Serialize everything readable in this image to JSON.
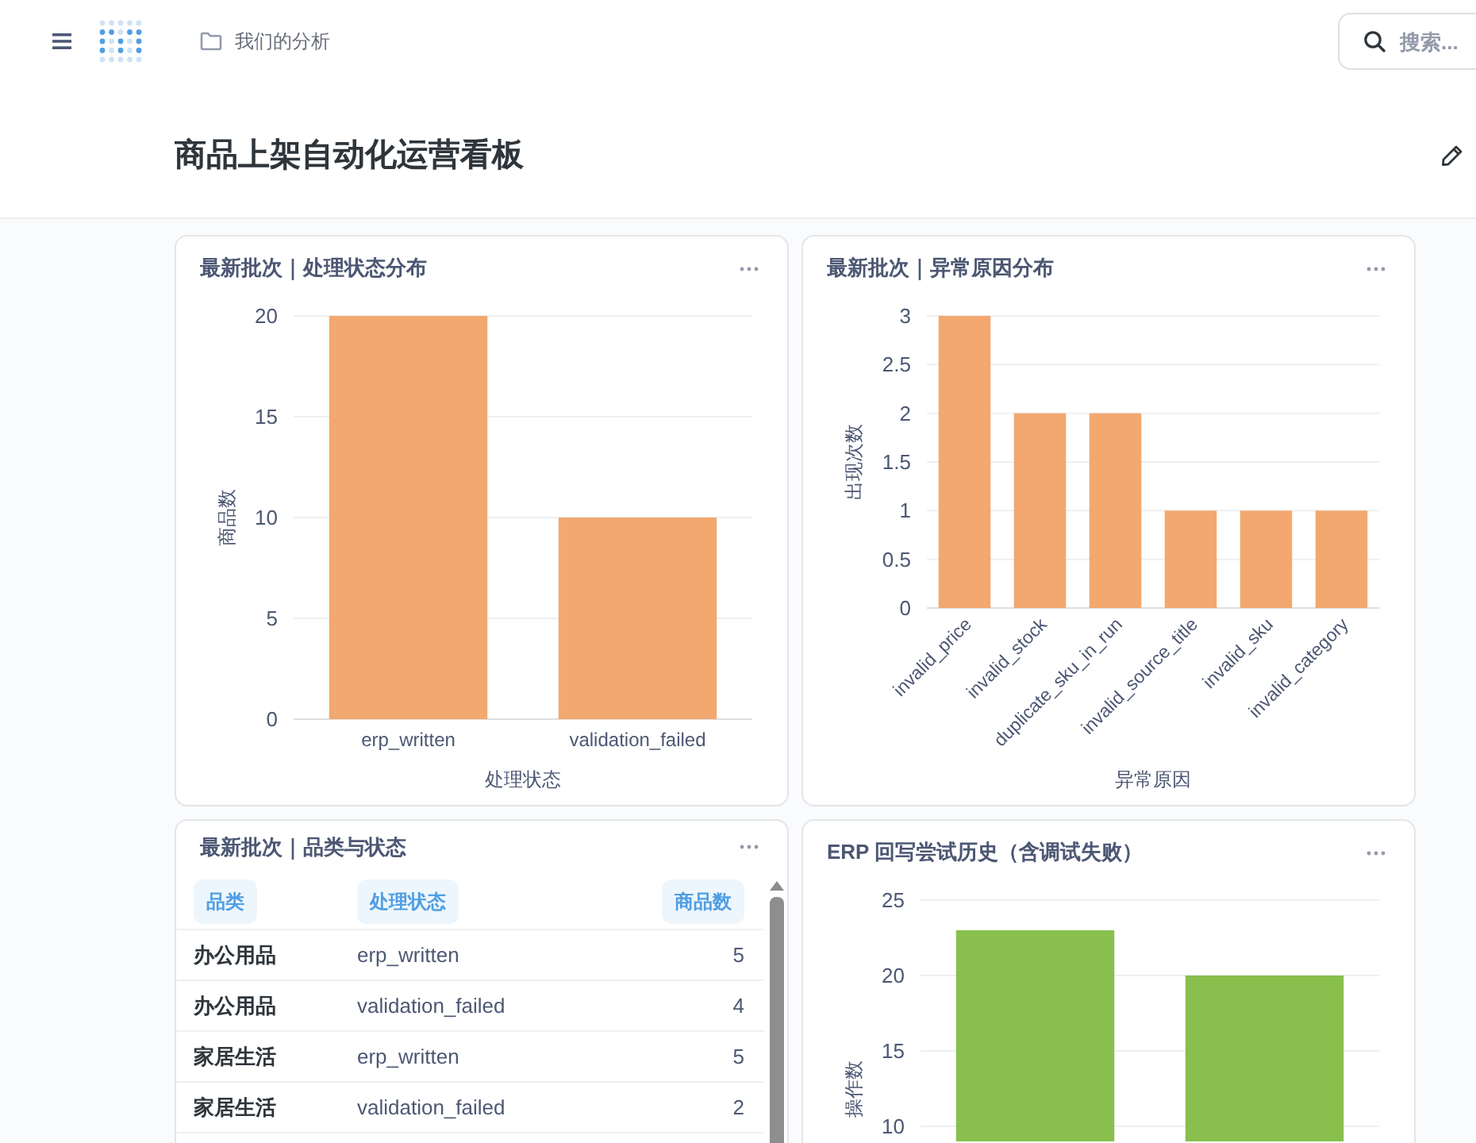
{
  "nav": {
    "breadcrumb": "我们的分析",
    "search": {
      "placeholder": "搜索..."
    }
  },
  "dashboard": {
    "title": "商品上架自动化运营看板"
  },
  "cards": [
    {
      "kind": "chart",
      "title": "最新批次｜处理状态分布",
      "chart_data": {
        "type": "bar",
        "xlabel": "处理状态",
        "ylabel": "商品数",
        "categories": [
          "erp_written",
          "validation_failed"
        ],
        "series": [
          {
            "color": "#f2a86f",
            "values": [
              20,
              10
            ]
          }
        ],
        "ylim": [
          0,
          20
        ],
        "yticks": [
          0,
          5,
          10,
          15,
          20
        ],
        "grid": true
      }
    },
    {
      "kind": "chart",
      "title": "最新批次｜异常原因分布",
      "chart_data": {
        "type": "bar",
        "xlabel": "异常原因",
        "ylabel": "出现次数",
        "categories": [
          "invalid_price",
          "invalid_stock",
          "duplicate_sku_in_run",
          "invalid_source_title",
          "invalid_sku",
          "invalid_category"
        ],
        "series": [
          {
            "color": "#f2a86f",
            "values": [
              3,
              2,
              2,
              1,
              1,
              1
            ]
          }
        ],
        "ylim": [
          0,
          3
        ],
        "yticks": [
          0,
          0.5,
          1,
          1.5,
          2,
          2.5,
          3
        ],
        "grid": true
      }
    },
    {
      "kind": "table",
      "title": "最新批次｜品类与状态",
      "columns": [
        {
          "label": "品类",
          "kind": "text"
        },
        {
          "label": "处理状态",
          "kind": "text"
        },
        {
          "label": "商品数",
          "kind": "number"
        }
      ],
      "rows": [
        [
          "办公用品",
          "erp_written",
          "5"
        ],
        [
          "办公用品",
          "validation_failed",
          "4"
        ],
        [
          "家居生活",
          "erp_written",
          "5"
        ],
        [
          "家居生活",
          "validation_failed",
          "2"
        ]
      ]
    },
    {
      "kind": "chart",
      "title": "ERP 回写尝试历史（含调试失败）",
      "chart_data": {
        "type": "bar",
        "ylabel": "操作数",
        "series": [
          {
            "color": "#88bf4d",
            "values": [
              23,
              20
            ]
          }
        ],
        "ylim": [
          9,
          25
        ],
        "yticks": [
          10,
          15,
          20,
          25
        ],
        "grid": true
      }
    }
  ]
}
